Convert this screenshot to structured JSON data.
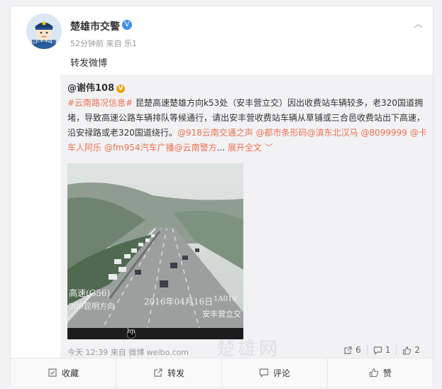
{
  "post": {
    "author": "楚雄市交警",
    "verified_badge": "V",
    "avatar_caption": "楚雄市交警",
    "meta": "52分钟前 来自 乐1",
    "text": "转发微博",
    "caret": "︿"
  },
  "original": {
    "author": "@谢伟108",
    "badge": "V",
    "text_parts": [
      {
        "t": "#云南路况信息#",
        "hl": true
      },
      {
        "t": " 昆楚高速楚雄方向k53处（安丰营立交）因出收费站车辆较多，老320国道拥堵，导致高速公路车辆排队等候通行，请出安丰营收费站车辆从草铺或三合邑收费站出下高速，沿安禄路或老320国道绕行。",
        "hl": false
      },
      {
        "t": "@918云南交通之声 @都市条形码@滇东北汉马 @8099999 @卡车人阿乐 @fm954汽车广播@云南警方",
        "hl": true
      },
      {
        "t": "... ",
        "hl": false
      }
    ],
    "expand_label": "展开全文 ﹀",
    "photo": {
      "cap_topleft": "高速(G56)",
      "cap_date": "2016年04月16日",
      "cap_direction": "200昆明方向",
      "cap_station": "安丰营立交",
      "cap_cam": "1A018",
      "cap_logo": "hp"
    },
    "meta": "今天 12:39 来自 微博 weibo.com",
    "actions": [
      {
        "icon": "share-icon",
        "count": "6"
      },
      {
        "icon": "comment-icon",
        "count": "1"
      },
      {
        "icon": "like-icon",
        "count": "2"
      }
    ]
  },
  "watermark": "楚雄网",
  "bottom": {
    "collect": "收藏",
    "forward": "转发",
    "comment": "评论",
    "like": "赞"
  }
}
